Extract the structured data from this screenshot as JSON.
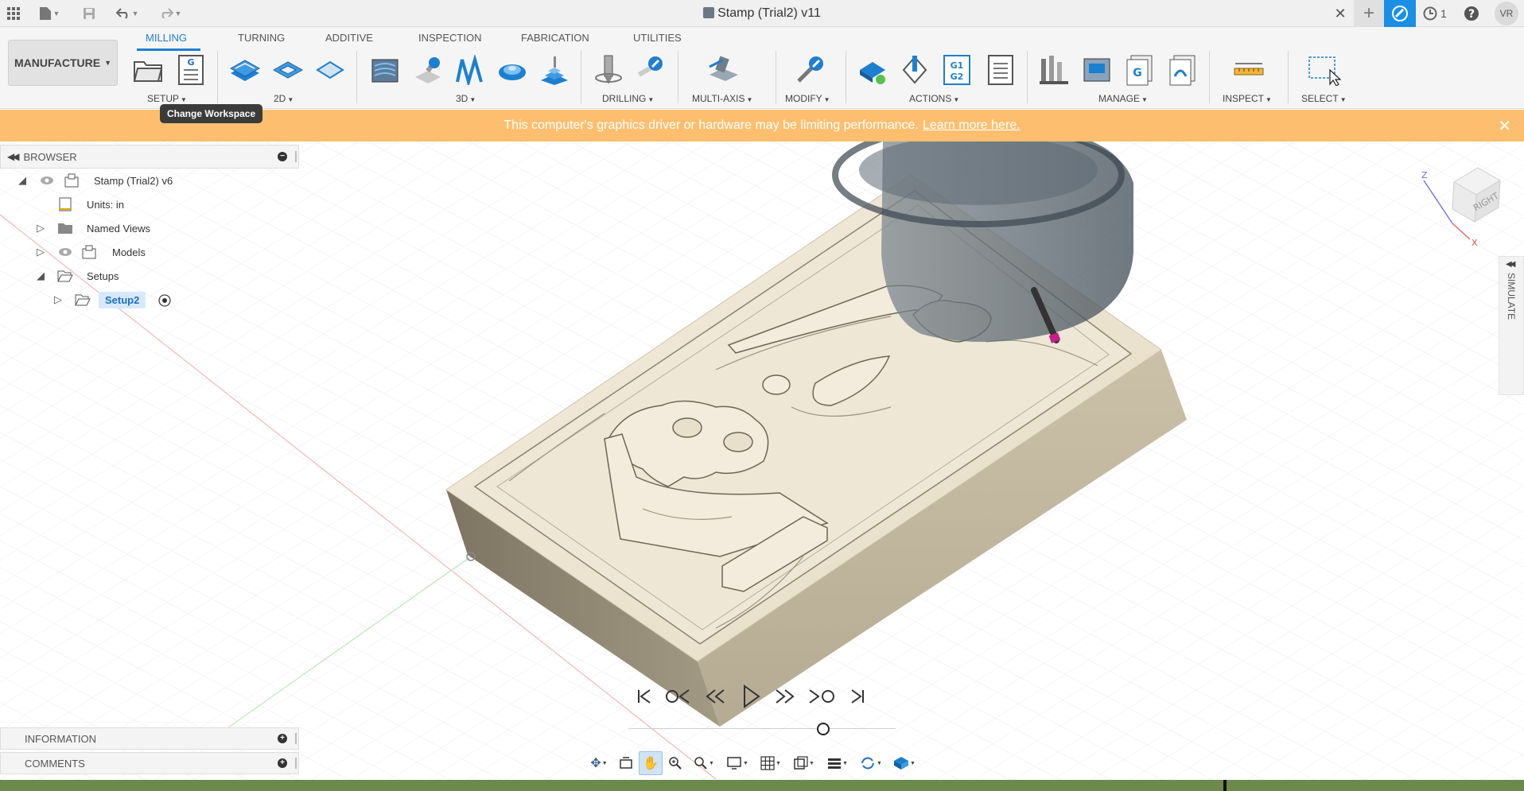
{
  "title_bar": {
    "document_title": "Stamp (Trial2) v11",
    "job_count": "1",
    "user_initials": "VR",
    "icons": [
      "grid-icon",
      "file-icon",
      "save-icon",
      "undo-icon",
      "redo-icon",
      "close-tab-icon",
      "new-tab-icon",
      "extensions-icon",
      "jobs-clock-icon",
      "help-icon",
      "user-avatar"
    ]
  },
  "ribbon": {
    "workspace_label": "MANUFACTURE",
    "tabs": [
      {
        "label": "MILLING",
        "active": true
      },
      {
        "label": "TURNING",
        "active": false
      },
      {
        "label": "ADDITIVE",
        "active": false
      },
      {
        "label": "INSPECTION",
        "active": false
      },
      {
        "label": "FABRICATION",
        "active": false
      },
      {
        "label": "UTILITIES",
        "active": false
      }
    ],
    "groups": [
      {
        "label": "SETUP"
      },
      {
        "label": "2D"
      },
      {
        "label": "3D"
      },
      {
        "label": "DRILLING"
      },
      {
        "label": "MULTI-AXIS"
      },
      {
        "label": "MODIFY"
      },
      {
        "label": "ACTIONS"
      },
      {
        "label": "MANAGE"
      },
      {
        "label": "INSPECT"
      },
      {
        "label": "SELECT"
      }
    ],
    "tool_icons": {
      "setup": [
        "setup-folder-icon",
        "nc-program-icon"
      ],
      "2d": [
        "2d-adaptive-icon",
        "2d-pocket-icon",
        "face-icon"
      ],
      "3d": [
        "adaptive-clearing-icon",
        "pocket-clearing-icon",
        "steep-shallow-icon",
        "scallop-icon",
        "contour-icon"
      ],
      "drilling": [
        "drill-icon",
        "probe-icon"
      ],
      "multi_axis": [
        "multi-axis-icon"
      ],
      "modify": [
        "modify-tool-icon"
      ],
      "actions": [
        "simulate-icon",
        "post-process-icon",
        "gcode-icon",
        "setup-sheet-icon"
      ],
      "manage": [
        "tool-library-icon",
        "machine-library-icon",
        "post-library-icon",
        "template-library-icon"
      ],
      "inspect": [
        "measure-icon"
      ],
      "select": [
        "select-box-icon"
      ]
    },
    "g_label": "G",
    "g1_label": "G1",
    "g2_label": "G2"
  },
  "tooltip": {
    "text": "Change Workspace"
  },
  "banner": {
    "message": "This computer's graphics driver or hardware may be limiting performance.",
    "link": "Learn more here."
  },
  "browser": {
    "header": "BROWSER",
    "items": [
      {
        "label": "Stamp (Trial2) v6",
        "expanded": true
      },
      {
        "label": "Units: in"
      },
      {
        "label": "Named Views",
        "expanded": false
      },
      {
        "label": "Models",
        "expanded": false
      },
      {
        "label": "Setups",
        "expanded": true
      },
      {
        "label": "Setup2",
        "expanded": false,
        "selected": true
      }
    ]
  },
  "bottom_panels": {
    "information": "INFORMATION",
    "comments": "COMMENTS"
  },
  "view_cube": {
    "face_label": "RIGHT",
    "axis_z": "Z",
    "axis_x": "X"
  },
  "simulate_panel": {
    "label": "SIMULATE"
  },
  "playback": {
    "buttons": [
      "go-to-start-icon",
      "previous-operation-icon",
      "step-back-icon",
      "play-icon",
      "step-forward-icon",
      "next-operation-icon",
      "go-to-end-icon"
    ],
    "position_fraction": 0.73
  },
  "nav_bar": {
    "buttons": [
      "orbit-icon",
      "look-at-icon",
      "pan-icon",
      "zoom-window-icon",
      "zoom-icon",
      "display-mode-icon",
      "grid-icon",
      "viewports-icon",
      "camera-icon",
      "refresh-icon",
      "environment-icon"
    ],
    "active": "pan-icon"
  },
  "colors": {
    "accent": "#1d7fd0",
    "banner": "#fdbf6f",
    "stock_top": "#efe6d3",
    "stock_side": "#8f8672",
    "status_bar": "#6b8a4b"
  }
}
